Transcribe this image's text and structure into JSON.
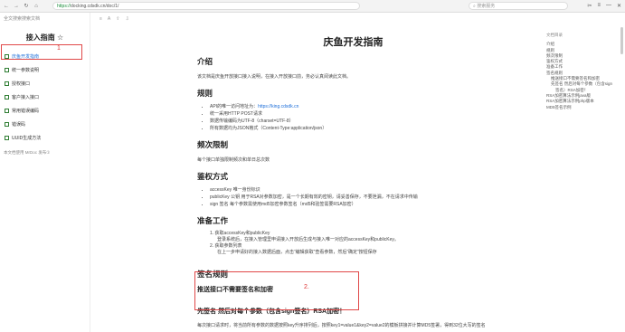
{
  "browser": {
    "url_protocol": "https://",
    "url_rest": "docking.cdsdk.cn/doc/1/",
    "search_placeholder": "搜索服务",
    "nav_icons": [
      "back-icon",
      "forward-icon",
      "reload-icon",
      "home-icon"
    ]
  },
  "sidebar": {
    "top_link": "全文搜索搜索文档",
    "title": "接入指南 ☆",
    "items": [
      {
        "label": "庆鱼开发指南",
        "active": true
      },
      {
        "label": "统一参数说明",
        "active": false
      },
      {
        "label": "授权接口",
        "active": false
      },
      {
        "label": "客户接入接口",
        "active": false
      },
      {
        "label": "常用错误编码",
        "active": false
      },
      {
        "label": "错误码",
        "active": false
      },
      {
        "label": "UUID生成方法",
        "active": false
      }
    ],
    "footer": "本文档使用 MrDoc 发布①",
    "annotation_1": "1"
  },
  "doc": {
    "title": "庆鱼开发指南",
    "intro_h": "介绍",
    "intro_p": "该文档是庆鱼开放接口接入说明，在接入开放接口前，务必认真阅读此文档。",
    "rules_h": "规则",
    "rules": [
      "API的唯一访问地址为：https://king.cdsdk.cn",
      "统一采用HTTP POST请求",
      "数据传输编码为UTF-8（charset=UTF-8）",
      "所有数据均为JSON格式（Content-Type:application/json）"
    ],
    "rules_link": "https://king.cdsdk.cn/",
    "freq_h": "频次限制",
    "freq_p": "每个接口单独限制频次和单日总次数",
    "auth_h": "鉴权方式",
    "auth": [
      "accessKey 唯一身份标识",
      "publicKey 公钥 用于RSA对参数加密，是一个长期有效的密钥，请妥善保存，不要泄漏，不在请求中传输",
      "sign 签名 每个参数需使用md5加密参数签名（md5和验签需要RSA加密）"
    ],
    "prep_h": "准备工作",
    "prep": [
      {
        "t": "获取accessKey和publicKey",
        "d": "登录系统后，在接入管理里申请接入开放后生成与接入唯一对应的accessKey和publicKey。"
      },
      {
        "t": "获取参数列表",
        "d": "在上一步申请好的接入数据后面，点击“编辑获取”查看参数，然后“确定”按钮保存"
      }
    ],
    "sign_h": "签名规则",
    "sign_sub": "推送接口不需要签名和加密",
    "sign_h2": "先签名 然后对每个参数（包含sign签名）RSA加密！",
    "sign_p": "每次接口请求时，将当前所有参数的数据按照key升序排列后，按照key1=value1&key2=value2的模板拼接并计算MD5签署，得到32位大写的签名",
    "annotation_2": "2."
  },
  "toc": {
    "header": "文档目录",
    "items": [
      {
        "label": "介绍",
        "level": 0
      },
      {
        "label": "规则",
        "level": 0
      },
      {
        "label": "频次限制",
        "level": 0
      },
      {
        "label": "鉴权方式",
        "level": 0
      },
      {
        "label": "准备工作",
        "level": 0
      },
      {
        "label": "签名规则",
        "level": 0
      },
      {
        "label": "推送接口不需要签名和加密",
        "level": 1
      },
      {
        "label": "先签名 然后对每个参数（包含sign",
        "level": 1
      },
      {
        "label": "签名）RSA加密！",
        "level": 2
      },
      {
        "label": "RSA加密算法示例java版",
        "level": 0
      },
      {
        "label": "RSA加密算法示例php版本",
        "level": 0
      },
      {
        "label": "MD5签名示例",
        "level": 0
      }
    ]
  }
}
